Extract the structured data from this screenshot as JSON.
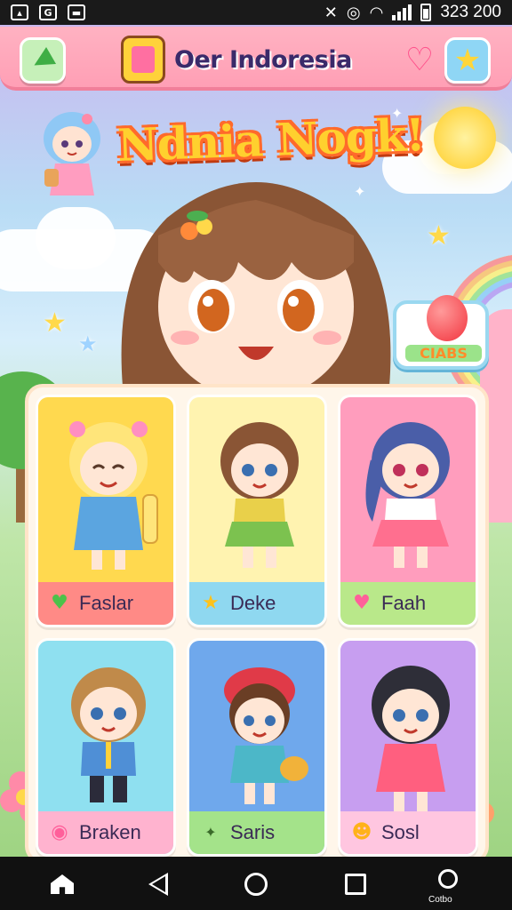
{
  "status_bar": {
    "time": "323 200",
    "left_icons": [
      "image-icon",
      "g-icon",
      "briefcase-icon"
    ],
    "right_icons": [
      "mute-icon",
      "alarm-icon",
      "wifi-icon",
      "signal-icon",
      "battery-icon"
    ]
  },
  "header": {
    "title": "Oer Indoresia",
    "back_icon": "back-arrow-icon",
    "logo_icon": "gift-box-icon",
    "heart_icon": "heart-icon",
    "favorite_icon": "star-icon"
  },
  "banner": {
    "title": "Ndnia Nogk!"
  },
  "promo_card": {
    "label": "CIABS",
    "icon": "balloon-icon"
  },
  "characters": [
    {
      "name": "Faslar",
      "badge": "heart-icon",
      "bg": "#ffd94f",
      "bar": "#ff8a86"
    },
    {
      "name": "Deke",
      "badge": "star-icon",
      "bg": "#fff3b0",
      "bar": "#8fd8f0"
    },
    {
      "name": "Faah",
      "badge": "heart-icon",
      "bg": "#ff9dbd",
      "bar": "#b9e88a"
    },
    {
      "name": "Braken",
      "badge": "circle-icon",
      "bg": "#8fe0f0",
      "bar": "#ffb3cf"
    },
    {
      "name": "Saris",
      "badge": "sparkle-icon",
      "bg": "#6fa8ec",
      "bar": "#a4e38a"
    },
    {
      "name": "Sosl",
      "badge": "sun-icon",
      "bg": "#c79ef0",
      "bar": "#ffc6e0"
    }
  ],
  "nav_bar": {
    "items": [
      "home-icon",
      "back-icon",
      "home-circle-icon",
      "recents-icon",
      "assistant-icon"
    ],
    "assistant_label": "Cotbo"
  },
  "colors": {
    "header_pink": "#ff9fb5",
    "title_yellow": "#ffd02e",
    "title_outline": "#ff6a2b"
  }
}
